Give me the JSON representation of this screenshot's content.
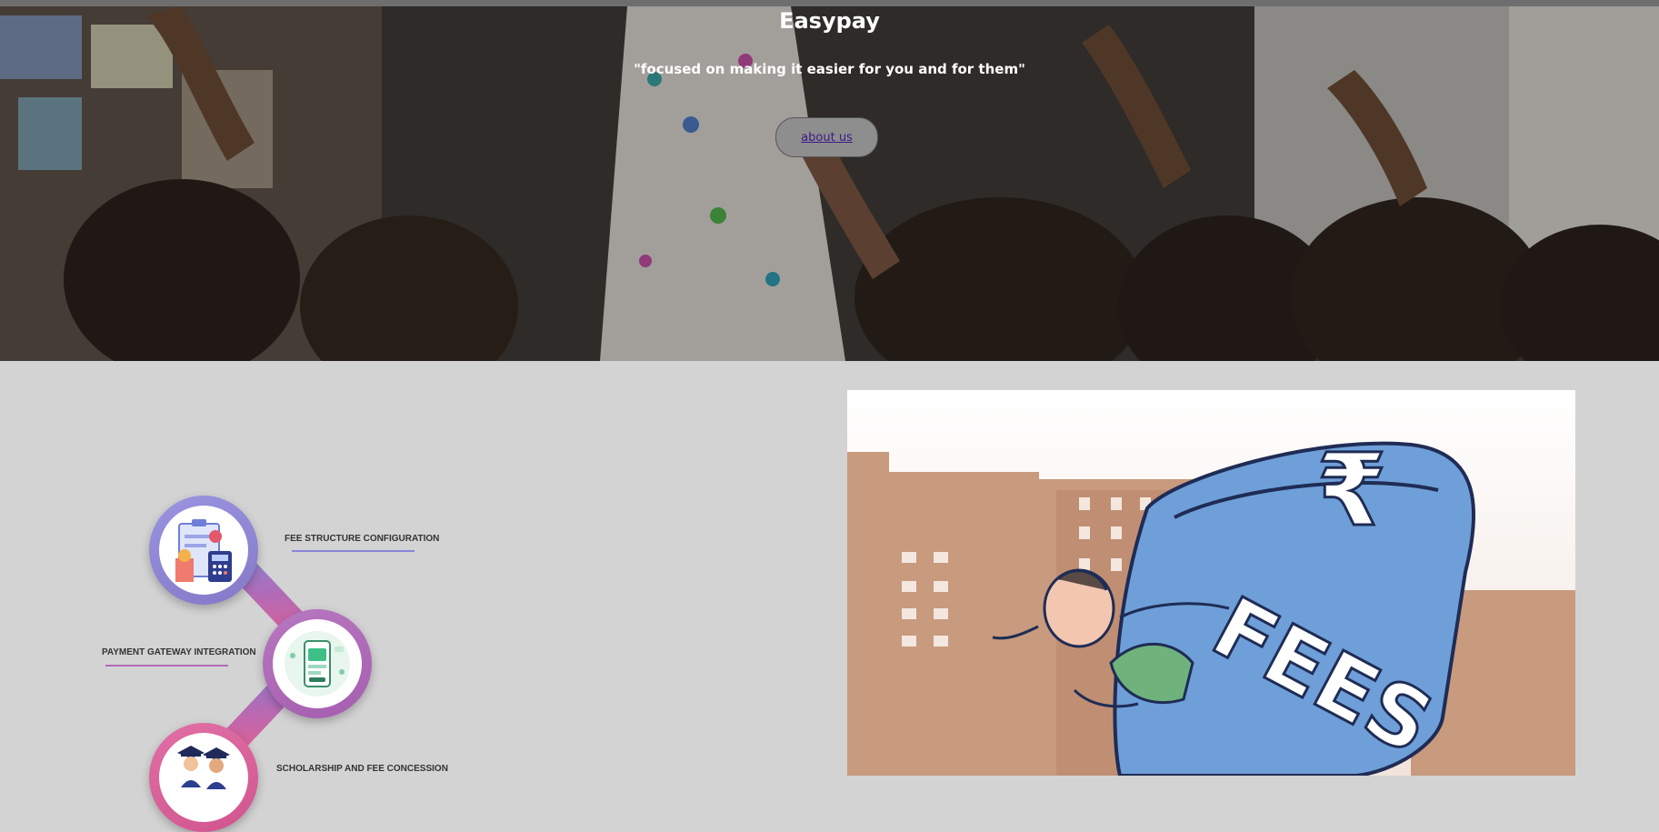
{
  "hero": {
    "title": "Easypay",
    "tagline": "\"focused on making it easier for you and for them\"",
    "about_button": "about us"
  },
  "steps": [
    {
      "label": "FEE STRUCTURE CONFIGURATION",
      "icon": "fee-structure-icon",
      "color": "#8b86d6"
    },
    {
      "label": "PAYMENT GATEWAY INTEGRATION",
      "icon": "payment-phone-icon",
      "color": "#b06bb7"
    },
    {
      "label": "SCHOLARSHIP AND FEE CONCESSION",
      "icon": "graduates-icon",
      "color": "#d8629c"
    }
  ],
  "fees_image": {
    "rupee_symbol": "₹",
    "text": "FEES"
  }
}
